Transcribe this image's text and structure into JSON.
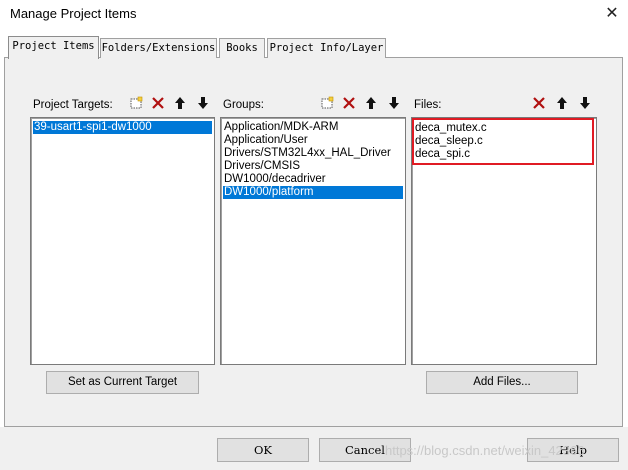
{
  "window": {
    "title": "Manage Project Items",
    "close_glyph": "✕"
  },
  "tabs": [
    {
      "label": "Project Items"
    },
    {
      "label": "Folders/Extensions"
    },
    {
      "label": "Books"
    },
    {
      "label": "Project Info/Layer"
    }
  ],
  "targets": {
    "label": "Project Targets:",
    "items": [
      "39-usart1-spi1-dw1000"
    ],
    "selected_index": 0,
    "button": "Set as Current Target"
  },
  "groups": {
    "label": "Groups:",
    "items": [
      "Application/MDK-ARM",
      "Application/User",
      "Drivers/STM32L4xx_HAL_Driver",
      "Drivers/CMSIS",
      "DW1000/decadriver",
      "DW1000/platform"
    ],
    "selected_index": 5
  },
  "files": {
    "label": "Files:",
    "items": [
      "deca_mutex.c",
      "deca_sleep.c",
      "deca_spi.c"
    ],
    "button": "Add Files..."
  },
  "toolbar_icons": {
    "new": "new-icon",
    "delete": "delete-icon",
    "up": "move-up-icon",
    "down": "move-down-icon"
  },
  "footer": {
    "ok": "OK",
    "cancel": "Cancel",
    "help": "Help"
  },
  "watermark": "https://blog.csdn.net/weixin_42366",
  "colors": {
    "selection": "#0078d7",
    "highlight_box": "#e01b24",
    "delete_icon": "#b01010"
  }
}
